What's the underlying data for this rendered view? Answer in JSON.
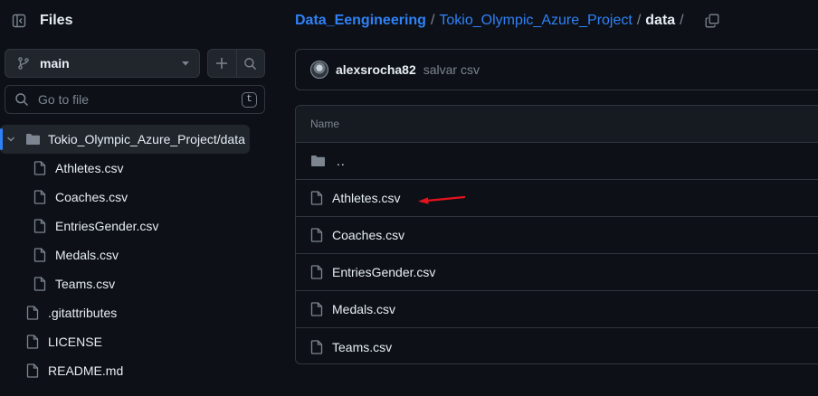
{
  "sidebar": {
    "title": "Files",
    "branch": "main",
    "search_placeholder": "Go to file",
    "search_shortcut": "t",
    "tree": [
      {
        "label": "Tokio_Olympic_Azure_Project/data",
        "type": "folder",
        "expanded": true,
        "selected": true
      },
      {
        "label": "Athletes.csv",
        "type": "file"
      },
      {
        "label": "Coaches.csv",
        "type": "file"
      },
      {
        "label": "EntriesGender.csv",
        "type": "file"
      },
      {
        "label": "Medals.csv",
        "type": "file"
      },
      {
        "label": "Teams.csv",
        "type": "file"
      },
      {
        "label": ".gitattributes",
        "type": "file"
      },
      {
        "label": "LICENSE",
        "type": "file"
      },
      {
        "label": "README.md",
        "type": "file"
      }
    ]
  },
  "breadcrumb": {
    "repo": "Data_Eengineering",
    "folder": "Tokio_Olympic_Azure_Project",
    "current": "data",
    "sep": "/"
  },
  "commit": {
    "author": "alexsrocha82",
    "message": "salvar csv"
  },
  "table": {
    "header": "Name",
    "parent_link": "..",
    "files": [
      "Athletes.csv",
      "Coaches.csv",
      "EntriesGender.csv",
      "Medals.csv",
      "Teams.csv"
    ]
  },
  "colors": {
    "background": "#0d1117",
    "link": "#2f81f7",
    "border": "#30363d",
    "annotation_arrow": "#e5121d"
  },
  "icons": [
    "sidebar-collapse-icon",
    "git-branch-icon",
    "triangle-down-icon",
    "plus-icon",
    "search-icon",
    "chevron-down-icon",
    "folder-icon",
    "file-icon",
    "copy-icon"
  ]
}
